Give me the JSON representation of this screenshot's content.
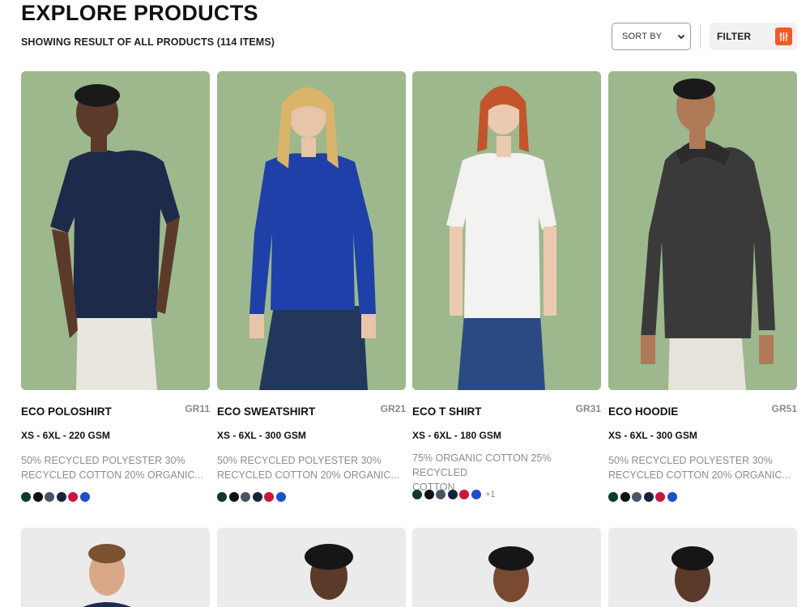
{
  "header": {
    "title": "EXPLORE PRODUCTS",
    "result_text": "SHOWING RESULT OF ALL PRODUCTS (114 ITEMS)",
    "sort_label": "SORT BY",
    "filter_label": "FILTER"
  },
  "products": [
    {
      "name": "ECO POLOSHIRT",
      "code": "GR11",
      "sizes": "XS - 6XL - 220 GSM",
      "material_line1": "50% RECYCLED POLYESTER 30%",
      "material_line2": "RECYCLED COTTON 20% ORGANIC...",
      "colors": [
        "#0f3b2a",
        "#111111",
        "#4a5563",
        "#15243d",
        "#c8163f",
        "#1e4fc8"
      ],
      "extra_colors": ""
    },
    {
      "name": "ECO SWEATSHIRT",
      "code": "GR21",
      "sizes": "XS - 6XL - 300 GSM",
      "material_line1": "50% RECYCLED POLYESTER 30%",
      "material_line2": "RECYCLED COTTON 20% ORGANIC...",
      "colors": [
        "#0f3b2a",
        "#111111",
        "#4a5563",
        "#15243d",
        "#c8163f",
        "#1e4fc8"
      ],
      "extra_colors": ""
    },
    {
      "name": "ECO T SHIRT",
      "code": "GR31",
      "sizes": "XS - 6XL - 180 GSM",
      "material_line1": "75% ORGANIC COTTON 25% RECYCLED",
      "material_line2": "COTTON",
      "colors": [
        "#0f3b2a",
        "#111111",
        "#4a5563",
        "#15243d",
        "#c8163f",
        "#1e4fc8"
      ],
      "extra_colors": "+1"
    },
    {
      "name": "ECO HOODIE",
      "code": "GR51",
      "sizes": "XS - 6XL - 300 GSM",
      "material_line1": "50% RECYCLED POLYESTER 30%",
      "material_line2": "RECYCLED COTTON 20% ORGANIC...",
      "colors": [
        "#0f3b2a",
        "#111111",
        "#4a5563",
        "#15243d",
        "#c8163f",
        "#1e4fc8"
      ],
      "extra_colors": ""
    }
  ],
  "icons": {
    "sort_chevron": "chevron-down-icon",
    "filter": "sliders-icon"
  },
  "accent_color": "#f15a24"
}
